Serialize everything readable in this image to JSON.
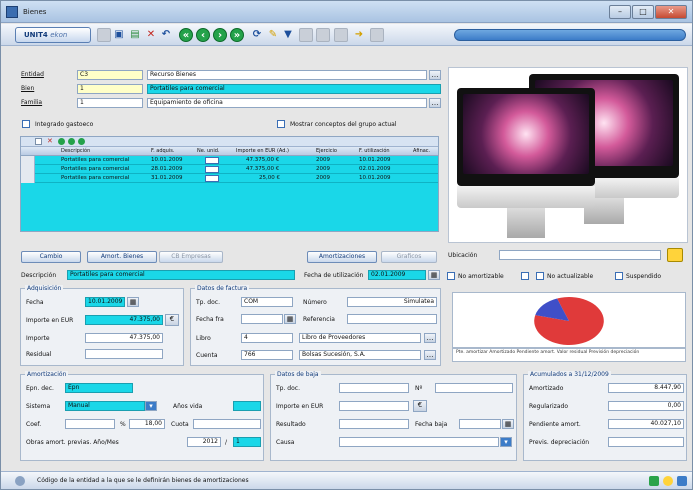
{
  "window": {
    "title": "Bienes"
  },
  "toolbar": {
    "unit_label": "UNIT4",
    "unit_sub": "ekon"
  },
  "form": {
    "entidad_label": "Entidad",
    "entidad_code": "C3",
    "entidad_name": "Recurso Bienes",
    "bien_label": "Bien",
    "bien_code": "1",
    "bien_name": "Portatiles para comercial",
    "familia_label": "Familia",
    "familia_code": "1",
    "familia_name": "Equipamiento de oficina",
    "integrado_label": "Integrado gastoeco",
    "mostrar_label": "Mostrar conceptos del grupo actual"
  },
  "grid": {
    "headers": [
      "Descripción",
      "F. adquis.",
      "Ne. unid.",
      "Importe en EUR (Ad.)",
      "Ejercicio",
      "F. utilización",
      "Afinac."
    ],
    "rows": [
      [
        "Portatiles para comercial",
        "10.01.2009",
        "",
        "47.375,00 €",
        "2009",
        "10.01.2009",
        ""
      ],
      [
        "Portatiles para comercial",
        "28.01.2009",
        "",
        "47.375,00 €",
        "2009",
        "02.01.2009",
        ""
      ],
      [
        "Portatiles para comercial",
        "31.01.2009",
        "",
        "25,00 €",
        "2009",
        "10.01.2009",
        ""
      ]
    ]
  },
  "buttons": {
    "cambio": "Cambio",
    "amort_bien": "Amort. Bienes",
    "cb": "CB Empresas",
    "amortizaciones": "Amortizaciones",
    "graficos": "Graficos"
  },
  "ubicacion_label": "Ubicación",
  "descripcion": {
    "label": "Descripción",
    "value": "Portatiles para comercial",
    "fecha_label": "Fecha de utilización",
    "fecha_value": "02.01.2009"
  },
  "checks": {
    "no_amort": "No amortizable",
    "no_actual": "No actualizable",
    "suspendido": "Suspendido"
  },
  "adquisicion": {
    "title": "Adquisición",
    "fecha_label": "Fecha",
    "fecha": "10.01.2009",
    "importe_label": "Importe en EUR",
    "importe": "47.375,00",
    "importe2_label": "Importe",
    "importe2": "47.375,00",
    "residual_label": "Residual"
  },
  "factura": {
    "title": "Datos de factura",
    "tp_doc_label": "Tp. doc.",
    "tp_doc": "COM",
    "numero_label": "Número",
    "numero": "Simulatea",
    "fecha_label": "Fecha fra",
    "referencia_label": "Referencia",
    "libro_label": "Libro",
    "libro": "4",
    "libro_name": "Libro de Proveedores",
    "cuenta_label": "Cuenta",
    "cuenta": "766",
    "cuenta_name": "Bolsas Sucesión, S.A."
  },
  "amortizacion": {
    "title": "Amortización",
    "epn_label": "Epn. dec.",
    "epn": "Epn",
    "sistema_label": "Sistema",
    "sistema": "Manual",
    "anos_label": "Años vida",
    "coef_label": "Coef.",
    "pct_label": "%",
    "pct": "18,00",
    "cuota_label": "Cuota",
    "otras_label": "Obras amort. previas. Año/Mes",
    "otras_year": "2012",
    "otras_num": "1"
  },
  "baja": {
    "title": "Datos de baja",
    "tp_doc_label": "Tp. doc.",
    "nf_label": "Nº",
    "importe_label": "Importe en EUR",
    "resultado_label": "Resultado",
    "fecha_label": "Fecha baja",
    "causa_label": "Causa"
  },
  "acumulados": {
    "title": "Acumulados a 31/12/2009",
    "rows": [
      {
        "label": "Amortizado",
        "value": "8.447,90"
      },
      {
        "label": "Regularizado",
        "value": "0,00"
      },
      {
        "label": "Pendiente amort.",
        "value": "40.027,10"
      },
      {
        "label": "Previs. depreciación",
        "value": ""
      }
    ]
  },
  "chart_data": {
    "type": "pie",
    "slices": [
      {
        "name": "Pte. amort.",
        "value": 84.5,
        "color": "#e03a3a"
      },
      {
        "name": "Amortizado",
        "value": 15.5,
        "color": "#3f4fc8"
      }
    ]
  },
  "pie_legend": "Pte. amortizar  Amortizado  Pendiente amort.  Valor residual  Previsión depreciación",
  "status": {
    "text": "Código de la entidad a la que se le definirán bienes de amortizaciones"
  }
}
